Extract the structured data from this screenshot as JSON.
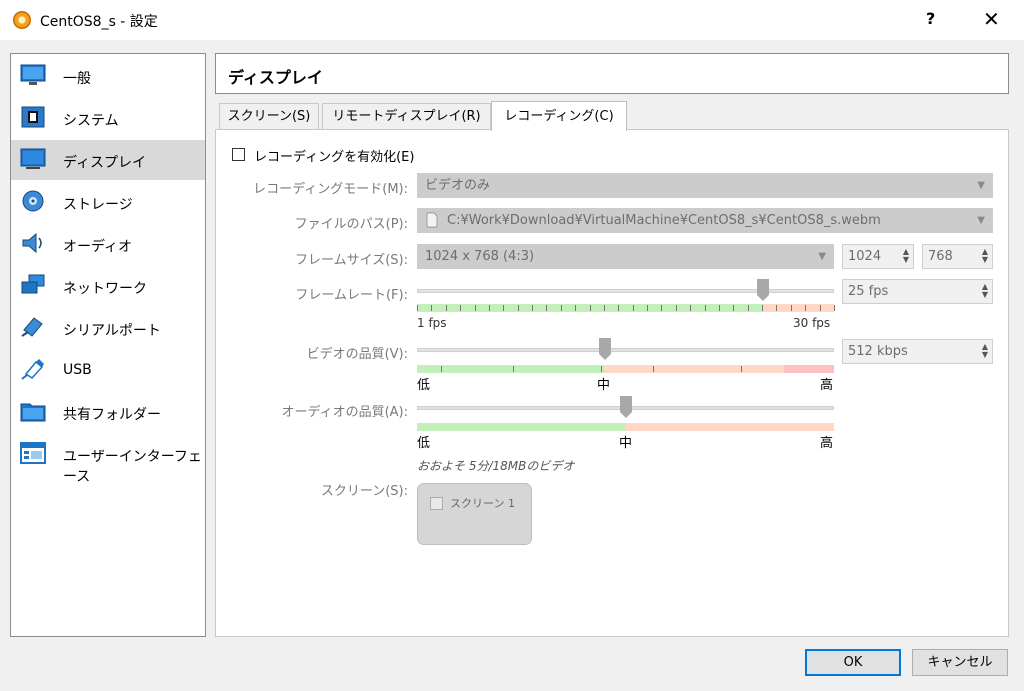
{
  "window": {
    "title": "CentOS8_s - 設定",
    "help": "?",
    "close": "✕"
  },
  "sidebar": {
    "items": [
      {
        "label": "一般",
        "icon": "monitor-general-icon"
      },
      {
        "label": "システム",
        "icon": "chip-icon"
      },
      {
        "label": "ディスプレイ",
        "icon": "display-icon",
        "selected": true
      },
      {
        "label": "ストレージ",
        "icon": "disk-icon"
      },
      {
        "label": "オーディオ",
        "icon": "speaker-icon"
      },
      {
        "label": "ネットワーク",
        "icon": "network-icon"
      },
      {
        "label": "シリアルポート",
        "icon": "serial-port-icon"
      },
      {
        "label": "USB",
        "icon": "usb-icon"
      },
      {
        "label": "共有フォルダー",
        "icon": "folder-icon"
      },
      {
        "label": "ユーザーインターフェース",
        "icon": "ui-window-icon"
      }
    ]
  },
  "header": {
    "title": "ディスプレイ"
  },
  "tabs": [
    {
      "label": "スクリーン(S)"
    },
    {
      "label": "リモートディスプレイ(R)"
    },
    {
      "label": "レコーディング(C)",
      "active": true
    }
  ],
  "recording": {
    "enable_label": "レコーディングを有効化(E)",
    "enabled": false,
    "mode_label": "レコーディングモード(M):",
    "mode_value": "ビデオのみ",
    "path_label": "ファイルのパス(P):",
    "path_value": "C:¥Work¥Download¥VirtualMachine¥CentOS8_s¥CentOS8_s.webm",
    "frame_size_label": "フレームサイズ(S):",
    "frame_size_value": "1024 x 768 (4:3)",
    "frame_width": "1024",
    "frame_height": "768",
    "frame_rate_label": "フレームレート(F):",
    "frame_rate_value": "25 fps",
    "frame_rate_min": "1 fps",
    "frame_rate_max": "30 fps",
    "frame_rate_level": 0.83,
    "video_quality_label": "ビデオの品質(V):",
    "video_quality_value": "512 kbps",
    "video_quality_level": 0.45,
    "audio_quality_label": "オーディオの品質(A):",
    "audio_quality_level": 0.5,
    "scale_low": "低",
    "scale_mid": "中",
    "scale_high": "高",
    "estimate": "おおよそ 5分/18MBのビデオ",
    "screens_label": "スクリーン(S):",
    "screen_item": "スクリーン 1"
  },
  "footer": {
    "ok": "OK",
    "cancel": "キャンセル"
  },
  "colors": {
    "selected_bg": "#d9d9d9",
    "default_button_border": "#0078d7",
    "scale_low": "#c3f0ba",
    "scale_high": "#ffd7c4"
  }
}
